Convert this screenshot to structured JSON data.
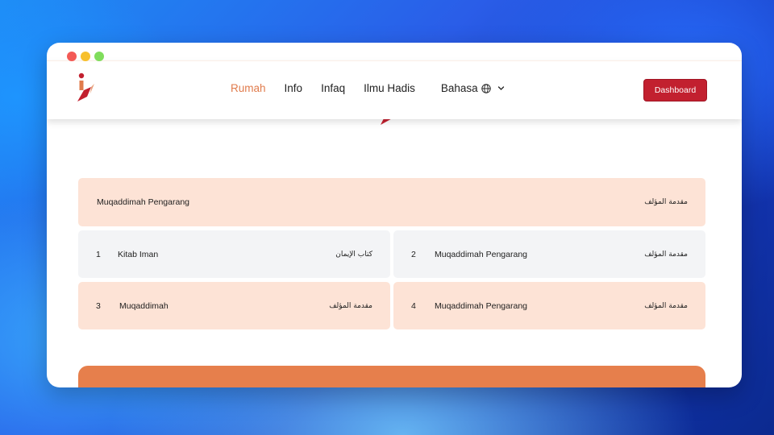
{
  "nav": {
    "links": [
      "Rumah",
      "Info",
      "Infaq",
      "Ilmu Hadis"
    ],
    "language_label": "Bahasa",
    "dashboard_label": "Dashboard"
  },
  "header_card": {
    "title": "Muqaddimah Pengarang",
    "arabic": "مقدمة المؤلف"
  },
  "chapters": [
    {
      "number": "1",
      "title": "Kitab Iman",
      "arabic": "كتاب الإيمان"
    },
    {
      "number": "2",
      "title": "Muqaddimah Pengarang",
      "arabic": "مقدمة المؤلف"
    },
    {
      "number": "3",
      "title": "Muqaddimah",
      "arabic": "مقدمة المؤلف"
    },
    {
      "number": "4",
      "title": "Muqaddimah Pengarang",
      "arabic": "مقدمة المؤلف"
    }
  ],
  "colors": {
    "accent": "#e07b4c",
    "brand_red": "#c2202f",
    "card_peach": "#fde3d6",
    "card_grey": "#f3f4f6",
    "footer_orange": "#e67f4c"
  },
  "icons": [
    "logo",
    "globe-icon",
    "chevron-down-icon"
  ]
}
